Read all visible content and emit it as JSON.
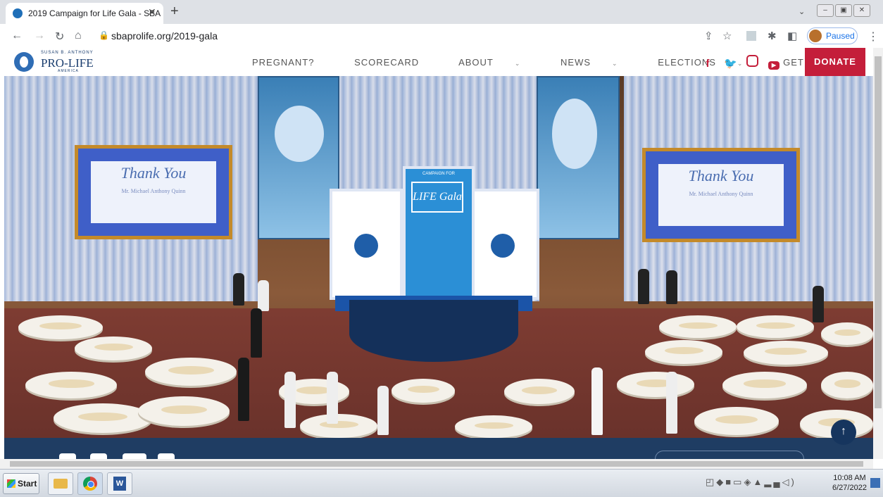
{
  "browser": {
    "tab_title": "2019 Campaign for Life Gala - SBA",
    "tab_close": "✕",
    "new_tab": "+",
    "url": "sbaprolife.org/2019-gala",
    "profile_status": "Paused"
  },
  "site": {
    "logo_small": "SUSAN B. ANTHONY",
    "logo_big": "PRO-LIFE",
    "logo_small2": "AMERICA",
    "nav": [
      {
        "label": "PREGNANT?"
      },
      {
        "label": "SCORECARD"
      },
      {
        "label": "ABOUT",
        "has_dropdown": true
      },
      {
        "label": "NEWS",
        "has_dropdown": true
      },
      {
        "label": "ELECTIONS",
        "has_dropdown": true
      },
      {
        "label": "GET INVOLVED",
        "has_dropdown": true
      }
    ],
    "social": [
      "facebook-icon",
      "twitter-icon",
      "instagram-icon",
      "youtube-icon"
    ],
    "donate_label": "DONATE",
    "brand_color": "#c41e3a",
    "navy_color": "#1f3d63"
  },
  "hero": {
    "screen_left_title": "Thank You",
    "screen_left_sub": "Mr. Michael Anthony Quinn",
    "screen_right_title": "Thank You",
    "screen_right_sub": "Mr. Michael Anthony Quinn",
    "gala_sign_top": "CAMPAIGN FOR",
    "gala_sign_main": "LIFE Gala"
  },
  "taskbar": {
    "start_label": "Start",
    "clock_time": "10:08 AM",
    "clock_date": "6/27/2022"
  }
}
